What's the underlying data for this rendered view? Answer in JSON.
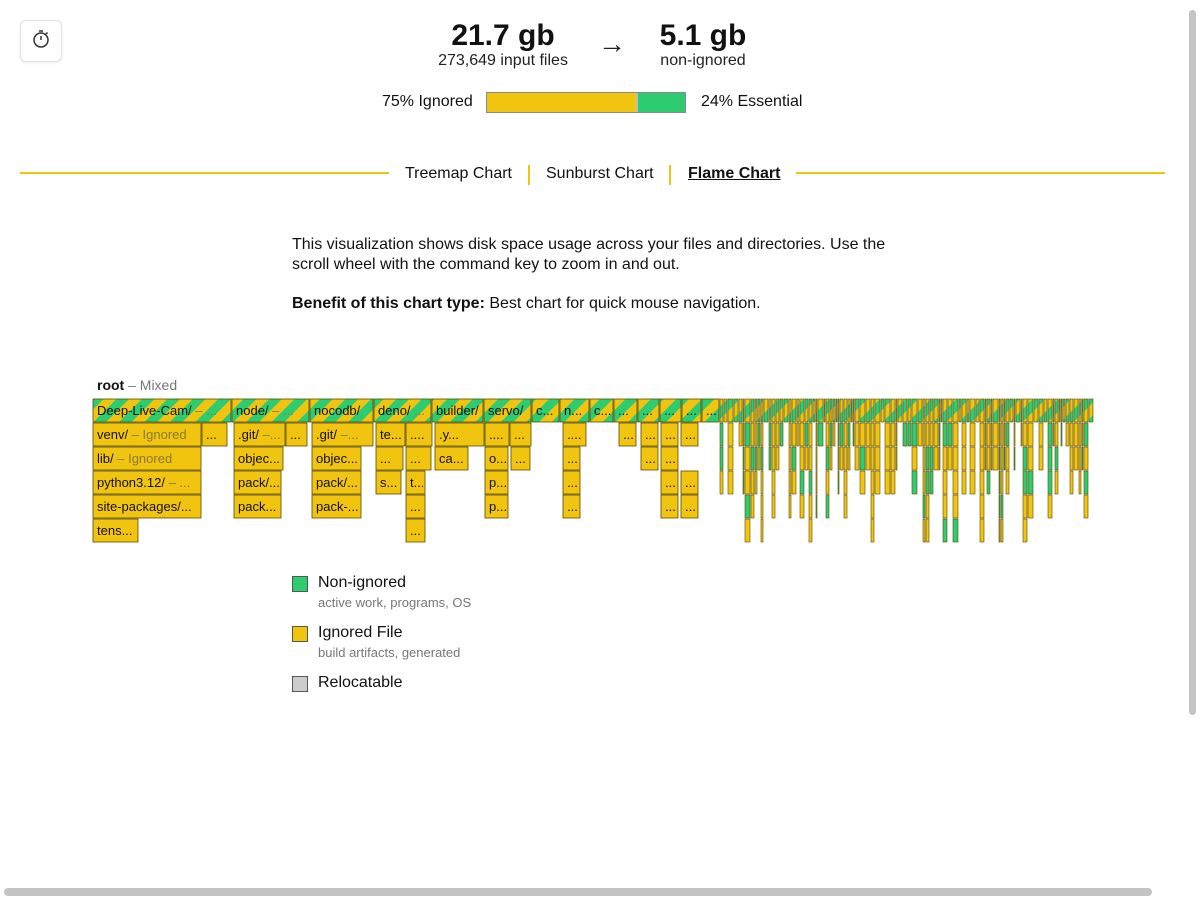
{
  "summary": {
    "input_size": "21.7 gb",
    "input_files": "273,649 input files",
    "arrow": "→",
    "output_size": "5.1 gb",
    "output_label": "non-ignored"
  },
  "ratio": {
    "ignored_label": "75% Ignored",
    "essential_label": "24% Essential",
    "ignored_fraction": 0.75,
    "essential_fraction": 0.24
  },
  "tabs": [
    {
      "label": "Treemap Chart",
      "active": false
    },
    {
      "label": "Sunburst Chart",
      "active": false
    },
    {
      "label": "Flame Chart",
      "active": true
    }
  ],
  "description": "This visualization shows disk space usage across your files and directories. Use the scroll wheel with the command key to zoom in and out.",
  "benefit": {
    "label": "Benefit of this chart type:",
    "text": "Best chart for quick mouse navigation."
  },
  "chart_title": {
    "name": "root",
    "status": "– Mixed"
  },
  "colors": {
    "non_ignored": "#2ecc71",
    "ignored": "#f1c40f",
    "relocatable": "#cccccc",
    "accent": "#f1c40f"
  },
  "legend": [
    {
      "label": "Non-ignored",
      "desc": "active work, programs, OS",
      "color": "#2ecc71"
    },
    {
      "label": "Ignored File",
      "desc": "build artifacts, generated",
      "color": "#f1c40f"
    },
    {
      "label": "Relocatable",
      "desc": "",
      "color": "#cccccc"
    }
  ],
  "chart_data": {
    "type": "flame",
    "total_units": 1000,
    "levels": [
      [
        {
          "label": "Deep-Live-Cam/",
          "suffix": "– ...",
          "status": "mixed",
          "start": 0,
          "size": 139
        },
        {
          "label": "node/",
          "suffix": "– ...",
          "status": "mixed",
          "start": 139,
          "size": 78
        },
        {
          "label": "nocodb/",
          "status": "mixed",
          "start": 217,
          "size": 64
        },
        {
          "label": "deno/",
          "suffix": "...",
          "status": "mixed",
          "start": 281,
          "size": 58
        },
        {
          "label": "builder/",
          "status": "mixed",
          "start": 339,
          "size": 52
        },
        {
          "label": "servo/",
          "status": "mixed",
          "start": 391,
          "size": 48
        },
        {
          "label": "c...",
          "status": "mixed",
          "start": 439,
          "size": 28
        },
        {
          "label": "n...",
          "status": "mixed",
          "start": 467,
          "size": 30
        },
        {
          "label": "c...",
          "status": "mixed",
          "start": 497,
          "size": 24
        },
        {
          "label": "...",
          "status": "mixed",
          "start": 521,
          "size": 24
        },
        {
          "label": "...",
          "status": "mixed",
          "start": 545,
          "size": 22
        },
        {
          "label": "...",
          "status": "mixed",
          "start": 567,
          "size": 22
        },
        {
          "label": "...",
          "status": "mixed",
          "start": 589,
          "size": 20
        },
        {
          "label": "...",
          "status": "mixed",
          "start": 609,
          "size": 18
        }
      ],
      [
        {
          "label": "venv/",
          "suffix": "– Ignored",
          "status": "ignored",
          "start": 0,
          "size": 109
        },
        {
          "label": "...",
          "status": "ignored",
          "start": 109,
          "size": 26
        },
        {
          "label": ".git/",
          "suffix": "–...",
          "status": "ignored",
          "start": 141,
          "size": 52
        },
        {
          "label": "...",
          "status": "ignored",
          "start": 193,
          "size": 22
        },
        {
          "label": ".git/",
          "suffix": "–...",
          "status": "ignored",
          "start": 219,
          "size": 62
        },
        {
          "label": "te...",
          "status": "ignored",
          "start": 283,
          "size": 30
        },
        {
          "label": "....",
          "status": "ignored",
          "start": 313,
          "size": 27
        },
        {
          "label": ".y...",
          "status": "ignored",
          "start": 342,
          "size": 50
        },
        {
          "label": "....",
          "status": "ignored",
          "start": 392,
          "size": 25
        },
        {
          "label": "...",
          "status": "ignored",
          "start": 417,
          "size": 22
        },
        {
          "label": "....",
          "status": "ignored",
          "start": 470,
          "size": 24
        },
        {
          "label": "...",
          "status": "ignored",
          "start": 526,
          "size": 18
        },
        {
          "label": "...",
          "status": "ignored",
          "start": 548,
          "size": 18
        },
        {
          "label": "...",
          "status": "ignored",
          "start": 568,
          "size": 18
        },
        {
          "label": "...",
          "status": "ignored",
          "start": 588,
          "size": 18
        }
      ],
      [
        {
          "label": "lib/",
          "suffix": "– Ignored",
          "status": "ignored",
          "start": 0,
          "size": 109
        },
        {
          "label": "objec...",
          "status": "ignored",
          "start": 141,
          "size": 50
        },
        {
          "label": "objec...",
          "status": "ignored",
          "start": 219,
          "size": 50
        },
        {
          "label": "...",
          "status": "ignored",
          "start": 283,
          "size": 28
        },
        {
          "label": "...",
          "status": "ignored",
          "start": 313,
          "size": 26
        },
        {
          "label": "ca...",
          "status": "ignored",
          "start": 342,
          "size": 34
        },
        {
          "label": "o...",
          "status": "ignored",
          "start": 392,
          "size": 24
        },
        {
          "label": "...",
          "status": "ignored",
          "start": 418,
          "size": 20
        },
        {
          "label": "...",
          "status": "ignored",
          "start": 470,
          "size": 18
        },
        {
          "label": "...",
          "status": "ignored",
          "start": 548,
          "size": 18
        },
        {
          "label": "...",
          "status": "ignored",
          "start": 568,
          "size": 18
        }
      ],
      [
        {
          "label": "python3.12/",
          "suffix": "– ...",
          "status": "ignored",
          "start": 0,
          "size": 109
        },
        {
          "label": "pack/...",
          "status": "ignored",
          "start": 141,
          "size": 48
        },
        {
          "label": "pack/...",
          "status": "ignored",
          "start": 219,
          "size": 50
        },
        {
          "label": "s...",
          "status": "ignored",
          "start": 283,
          "size": 26
        },
        {
          "label": "t...",
          "status": "ignored",
          "start": 313,
          "size": 20
        },
        {
          "label": "p...",
          "status": "ignored",
          "start": 392,
          "size": 24
        },
        {
          "label": "...",
          "status": "ignored",
          "start": 470,
          "size": 18
        },
        {
          "label": "...",
          "status": "ignored",
          "start": 568,
          "size": 18
        },
        {
          "label": "...",
          "status": "ignored",
          "start": 588,
          "size": 18
        }
      ],
      [
        {
          "label": "site-packages/...",
          "status": "ignored",
          "start": 0,
          "size": 109
        },
        {
          "label": "pack...",
          "status": "ignored",
          "start": 141,
          "size": 48
        },
        {
          "label": "pack-...",
          "status": "ignored",
          "start": 219,
          "size": 50
        },
        {
          "label": "...",
          "status": "ignored",
          "start": 313,
          "size": 20
        },
        {
          "label": "p...",
          "status": "ignored",
          "start": 392,
          "size": 24
        },
        {
          "label": "...",
          "status": "ignored",
          "start": 470,
          "size": 18
        },
        {
          "label": "...",
          "status": "ignored",
          "start": 568,
          "size": 18
        },
        {
          "label": "...",
          "status": "ignored",
          "start": 588,
          "size": 18
        }
      ],
      [
        {
          "label": "tens...",
          "status": "ignored",
          "start": 0,
          "size": 46
        },
        {
          "label": "...",
          "status": "ignored",
          "start": 313,
          "size": 20
        }
      ]
    ]
  }
}
